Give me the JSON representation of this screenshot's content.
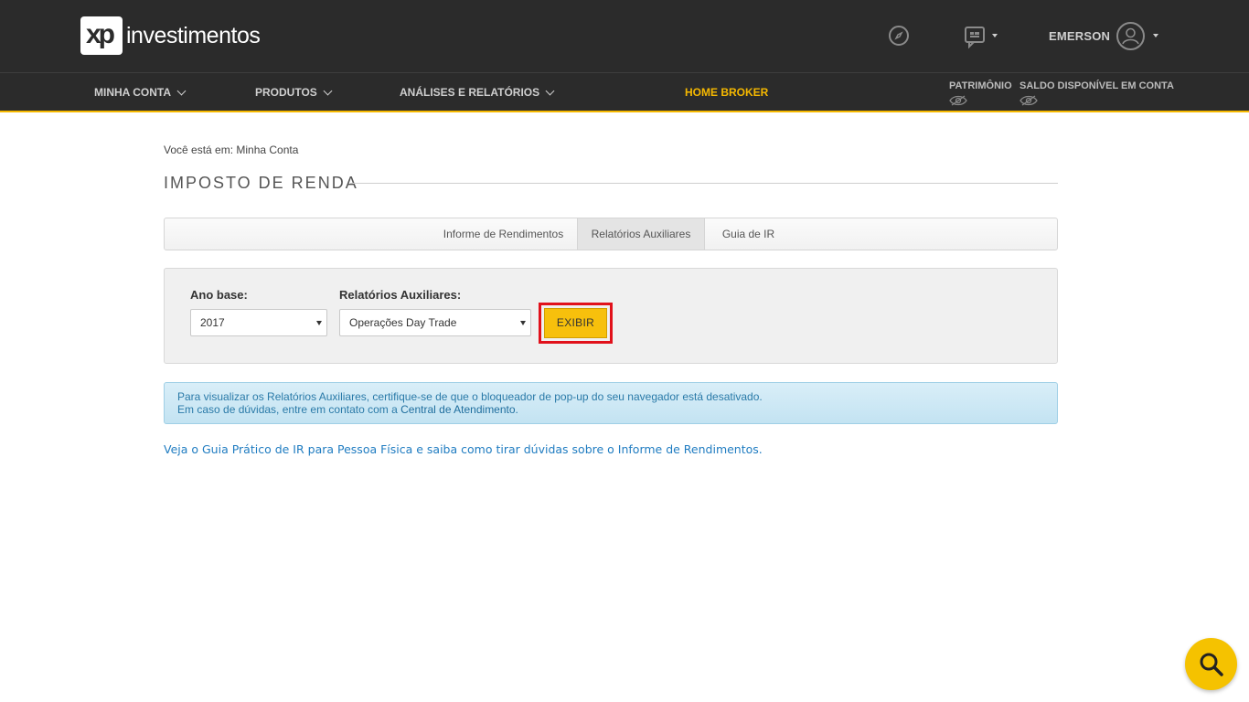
{
  "header": {
    "logo_mark": "xp",
    "logo_text": "investimentos",
    "user_name": "EMERSON"
  },
  "nav": {
    "items": [
      {
        "label": "MINHA CONTA"
      },
      {
        "label": "PRODUTOS"
      },
      {
        "label": "ANÁLISES E RELATÓRIOS"
      }
    ],
    "home_broker": "HOME BROKER",
    "patrimonio": "PATRIMÔNIO",
    "saldo": "SALDO DISPONÍVEL EM CONTA"
  },
  "breadcrumb": "Você está em: Minha Conta",
  "page_title": "IMPOSTO DE RENDA",
  "tabs": [
    {
      "label": "Informe de Rendimentos"
    },
    {
      "label": "Relatórios Auxiliares",
      "active": true
    },
    {
      "label": "Guia de IR"
    }
  ],
  "filters": {
    "year_label": "Ano base:",
    "year_value": "2017",
    "report_label": "Relatórios Auxiliares:",
    "report_value": "Operações Day Trade",
    "button_label": "EXIBIR"
  },
  "alert": {
    "line1": "Para visualizar os Relatórios Auxiliares, certifique-se de que o bloqueador de pop-up do seu navegador está desativado.",
    "line2_prefix": "Em caso de dúvidas, entre em contato com a ",
    "line2_link": "Central de Atendimento",
    "line2_suffix": "."
  },
  "guide_link": "Veja o Guia Prático de IR para Pessoa Física e saiba como tirar dúvidas sobre o Informe de Rendimentos.",
  "colors": {
    "header_bg": "#2b2b2b",
    "accent": "#f5b800",
    "highlight_border": "#e1111b",
    "link": "#1f7cc1"
  }
}
